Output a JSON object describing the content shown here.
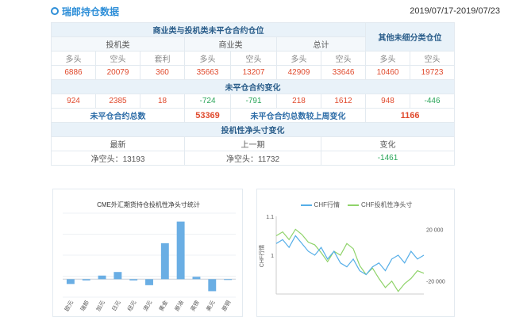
{
  "header": {
    "title": "瑞郎持仓数据",
    "date_range": "2019/07/17-2019/07/23"
  },
  "table": {
    "main_header": "商业类与投机类未平仓合约仓位",
    "other_header": "其他未细分类仓位",
    "group_spec": "投机类",
    "group_comm": "商业类",
    "group_total": "总计",
    "col_long": "多头",
    "col_short": "空头",
    "col_spread": "套利",
    "positions": [
      "6886",
      "20079",
      "360",
      "35663",
      "13207",
      "42909",
      "33646",
      "10460",
      "19723"
    ],
    "change_title": "未平仓合约变化",
    "changes": [
      "924",
      "2385",
      "18",
      "-724",
      "-791",
      "218",
      "1612",
      "948",
      "-446"
    ],
    "oi_total_label": "未平仓合约总数",
    "oi_total_value": "53369",
    "oi_week_label": "未平仓合约总数较上周变化",
    "oi_week_value": "1166",
    "net_title": "投机性净头寸变化",
    "latest_label": "最新",
    "prev_label": "上一期",
    "change_label": "变化",
    "latest_value": "净空头：13193",
    "prev_value": "净空头：11732",
    "change_value": "-1461"
  },
  "colors": {
    "accent": "#2f8fd8",
    "bar": "#6aaee4",
    "chf_line": "#55aee8",
    "net_line": "#8fd36a",
    "red": "#e04a2d",
    "green": "#2aa55a"
  },
  "chart_data": [
    {
      "type": "bar",
      "title": "CME外汇期货持仓投机性净头寸统计",
      "categories": [
        "欧元",
        "瑞郎",
        "加元",
        "日元",
        "纽元",
        "澳元",
        "黄金",
        "原油",
        "英镑",
        "美元",
        "原铜"
      ],
      "values": [
        -4,
        -1,
        3,
        6,
        -1,
        -5,
        30,
        48,
        2,
        -10,
        0
      ],
      "ylim": [
        -15,
        55
      ]
    },
    {
      "type": "line",
      "series": [
        {
          "name": "CHF行情",
          "values": [
            1.03,
            1.04,
            1.02,
            1.05,
            1.03,
            1.01,
            1.0,
            1.02,
            0.99,
            1.01,
            0.98,
            0.97,
            0.99,
            0.96,
            0.95,
            0.97,
            0.98,
            0.96,
            0.99,
            1.0,
            0.98,
            1.01,
            0.99,
            1.0
          ]
        },
        {
          "name": "CHF投机性净头寸",
          "values": [
            15000,
            18000,
            12000,
            20000,
            16000,
            10000,
            8000,
            2000,
            -5000,
            3000,
            0,
            9000,
            5000,
            -8000,
            -15000,
            -10000,
            -18000,
            -25000,
            -20000,
            -28000,
            -22000,
            -18000,
            -12000,
            -14000
          ]
        }
      ],
      "ylabel": "CHF行情",
      "left_ticks": [
        "1.1",
        "1"
      ],
      "right_ticks": [
        "20 000",
        "-20 000"
      ]
    }
  ]
}
